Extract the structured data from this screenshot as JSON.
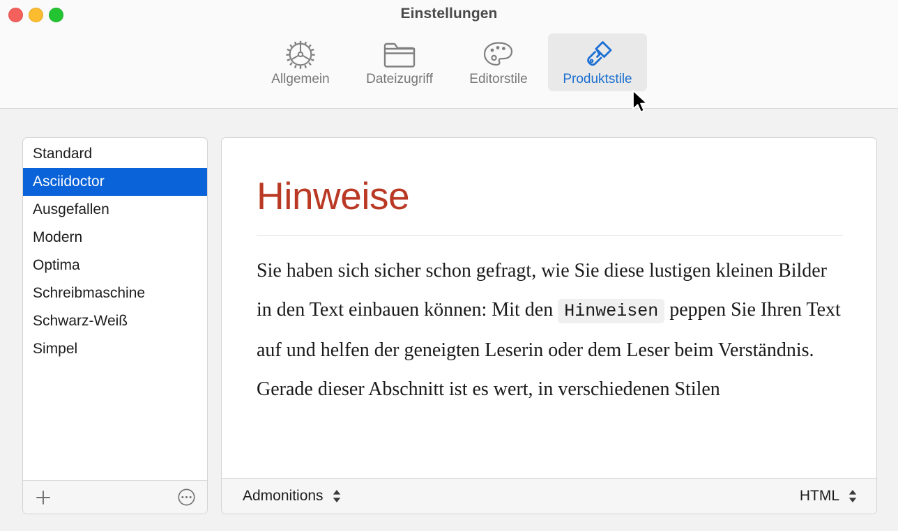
{
  "window": {
    "title": "Einstellungen",
    "traffic_lights": [
      "close",
      "minimize",
      "maximize"
    ]
  },
  "toolbar": {
    "items": [
      {
        "label": "Allgemein",
        "icon": "gear-icon",
        "selected": false
      },
      {
        "label": "Dateizugriff",
        "icon": "folder-icon",
        "selected": false
      },
      {
        "label": "Editorstile",
        "icon": "palette-icon",
        "selected": false
      },
      {
        "label": "Produktstile",
        "icon": "paintbrush-icon",
        "selected": true
      }
    ],
    "selected_color": "#1c6fd0",
    "inactive_color": "#777777"
  },
  "sidebar": {
    "items": [
      {
        "label": "Standard",
        "selected": false
      },
      {
        "label": "Asciidoctor",
        "selected": true
      },
      {
        "label": "Ausgefallen",
        "selected": false
      },
      {
        "label": "Modern",
        "selected": false
      },
      {
        "label": "Optima",
        "selected": false
      },
      {
        "label": "Schreibmaschine",
        "selected": false
      },
      {
        "label": "Schwarz-Weiß",
        "selected": false
      },
      {
        "label": "Simpel",
        "selected": false
      }
    ],
    "selection_color": "#0a63d8",
    "footer": {
      "add_label": "+",
      "add_icon": "plus-icon",
      "more_icon": "ellipsis-circle-icon"
    }
  },
  "preview": {
    "heading": "Hinweise",
    "heading_color": "#ba3925",
    "paragraph": {
      "part1": "Sie haben sich sicher schon gefragt, wie Sie diese lustigen kleinen Bilder in den Text einbauen können: Mit den",
      "code": "Hinweisen",
      "part2": "peppen Sie Ihren Text auf und helfen der geneigten Leserin oder dem Leser beim Verständnis. Gerade dieser Abschnitt ist es wert, in verschiedenen Stilen"
    },
    "footer": {
      "left_popup": {
        "value": "Admonitions",
        "icon": "chevron-up-down-icon"
      },
      "right_popup": {
        "value": "HTML",
        "icon": "chevron-up-down-icon"
      }
    }
  },
  "cursor": {
    "icon": "arrow-pointer-icon"
  }
}
